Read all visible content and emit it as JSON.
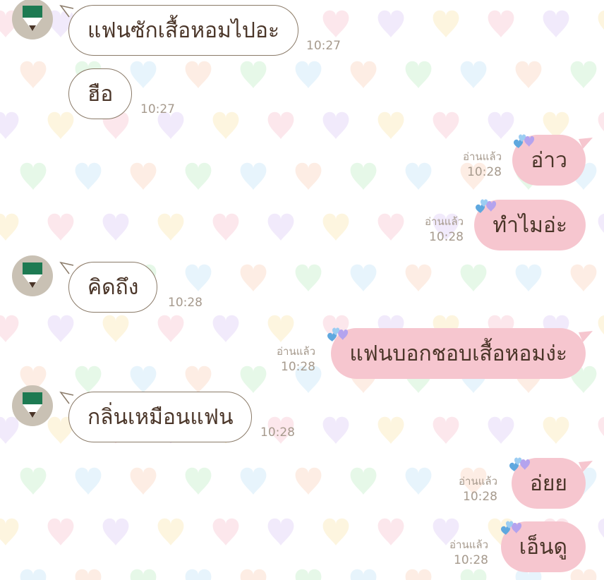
{
  "chat": {
    "messages": [
      {
        "side": "in",
        "text": "แฟนซักเสื้อหอมไปอะ",
        "time": "10:27",
        "avatar": true
      },
      {
        "side": "in",
        "text": "ฮือ",
        "time": "10:27",
        "avatar": false
      },
      {
        "side": "out",
        "text": "อ่าว",
        "time": "10:28",
        "read": "อ่านแล้ว"
      },
      {
        "side": "out",
        "text": "ทำไมอ่ะ",
        "time": "10:28",
        "read": "อ่านแล้ว"
      },
      {
        "side": "in",
        "text": "คิดถึง",
        "time": "10:28",
        "avatar": true
      },
      {
        "side": "out",
        "text": "แฟนบอกชอบเสื้อหอมง่ะ",
        "time": "10:28",
        "read": "อ่านแล้ว"
      },
      {
        "side": "in",
        "text": "กลิ่นเหมือนแฟน",
        "time": "10:28",
        "avatar": true
      },
      {
        "side": "out",
        "text": "อ่ยย",
        "time": "10:28",
        "read": "อ่านแล้ว"
      },
      {
        "side": "out",
        "text": "เอ็นดู",
        "time": "10:28",
        "read": "อ่านแล้ว"
      }
    ]
  },
  "theme": {
    "incoming_bubble": "#ffffff",
    "incoming_border": "#8a7a68",
    "outgoing_bubble": "#f6c6cf",
    "text": "#4a3528",
    "meta_text": "#a69a8d",
    "avatar_bg": "#c9c1b4",
    "avatar_icon": "#1d7a52",
    "heart_colors": [
      "#f8c9d4",
      "#c9e6f8",
      "#fbe9b7",
      "#c8f0cd",
      "#e0d0f6",
      "#fbd7c4"
    ]
  },
  "icons": {
    "avatar": "green-pencil-icon",
    "bubble_decoration": "hearts-icon"
  }
}
